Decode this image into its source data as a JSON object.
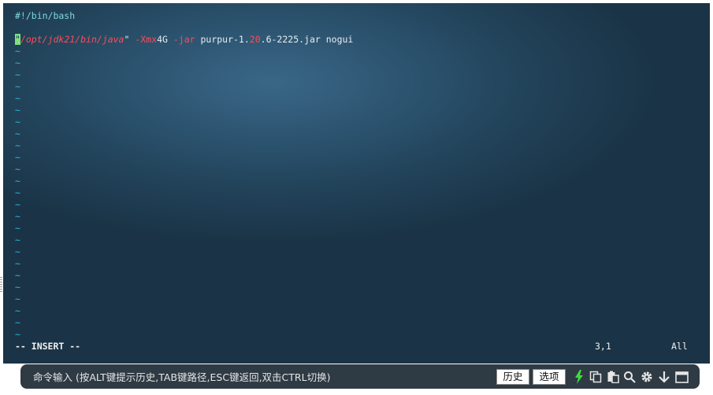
{
  "terminal": {
    "shebang": "#!/bin/bash",
    "command": {
      "cursor_char": "\"",
      "path": "/opt/jdk21/bin/java",
      "close_quote": "\"",
      "flag_xmx": " -Xmx",
      "xmx_value": "4G",
      "flag_jar": " -jar",
      "jar_prefix": " purpur-1.",
      "jar_version_highlight": "20",
      "jar_suffix": ".6-2225.jar nogui"
    },
    "tilde": "~",
    "status_mode": "-- INSERT --",
    "status_position": "3,1",
    "status_scroll": "All"
  },
  "command_bar": {
    "placeholder": "命令输入 (按ALT键提示历史,TAB键路径,ESC键返回,双击CTRL切换)",
    "history_label": "历史",
    "options_label": "选项",
    "icons": [
      "lightning-icon",
      "copy-icon",
      "paste-icon",
      "search-icon",
      "gear-icon",
      "download-icon",
      "window-icon"
    ]
  },
  "colors": {
    "terminal_bg": "#22435a",
    "tilde": "#2fb7d6",
    "string": "#ff4a5a",
    "cursor": "#7fe07f",
    "lightning": "#3ddc3d"
  }
}
